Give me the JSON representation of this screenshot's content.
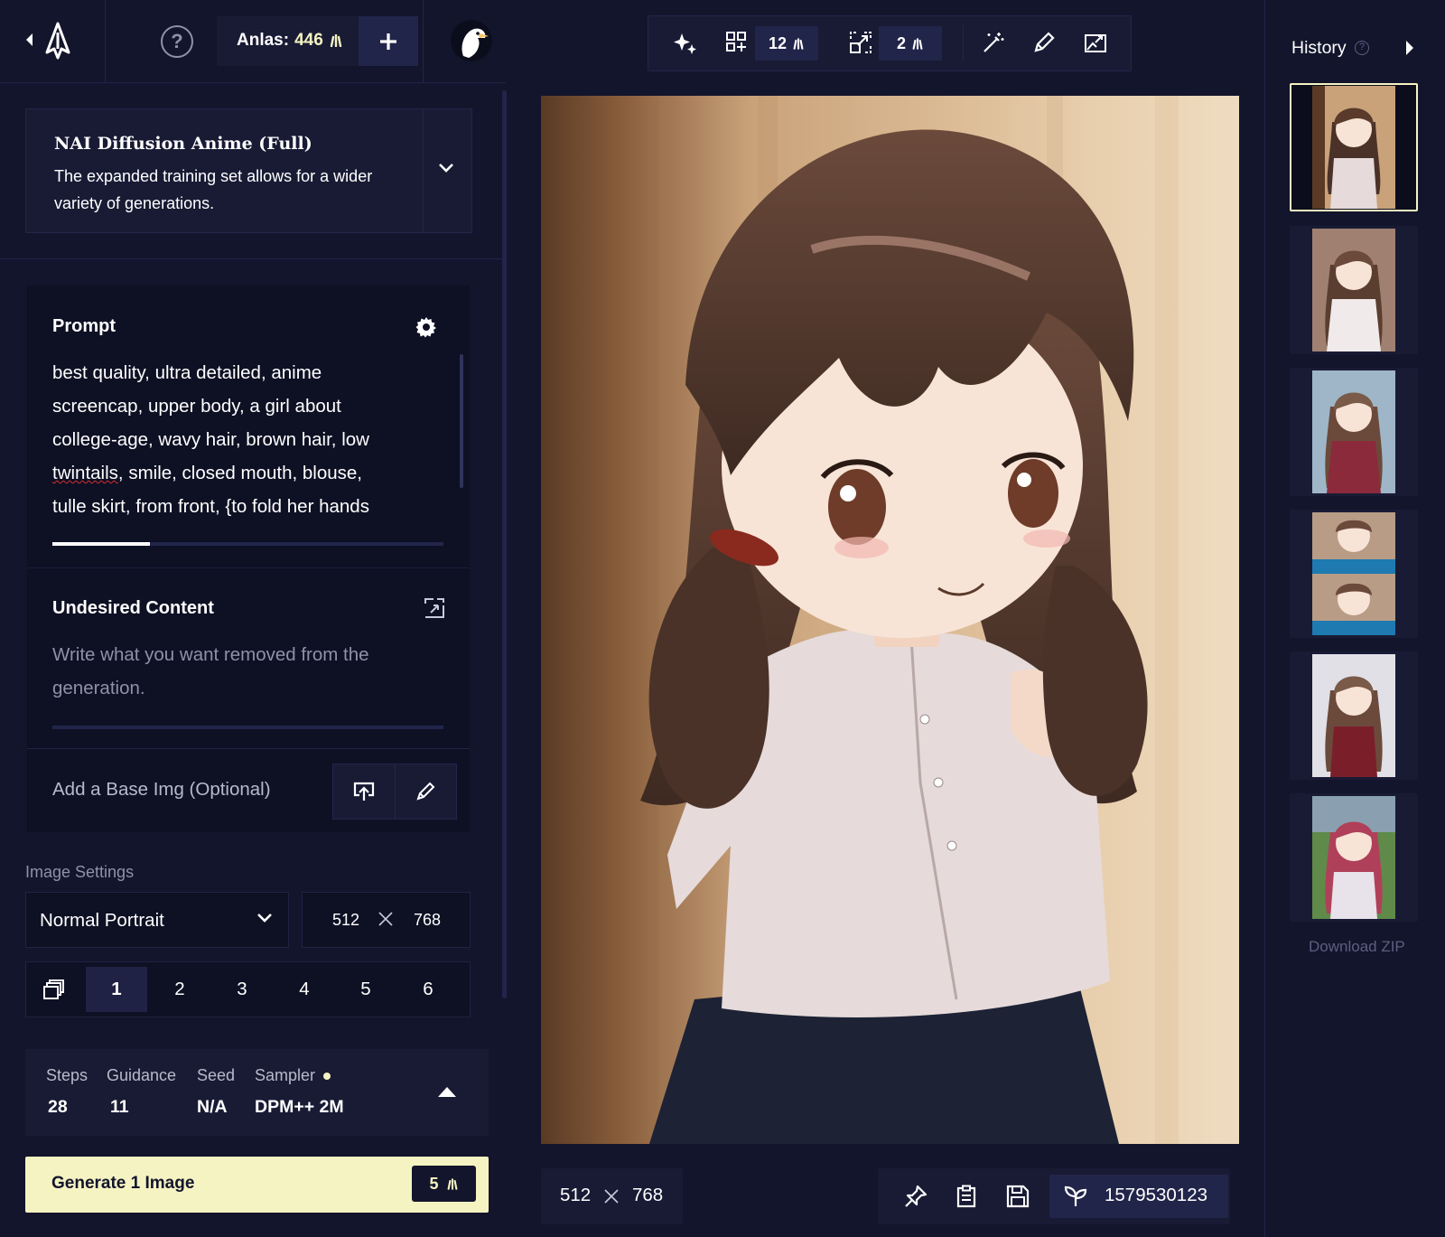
{
  "topbar": {
    "anlas_label": "Anlas:",
    "anlas_value": "446",
    "help_label": "?"
  },
  "model": {
    "title": "NAI Diffusion Anime (Full)",
    "description": "The expanded training set allows for a wider variety of generations."
  },
  "prompt": {
    "title": "Prompt",
    "text_before": "best quality,  ultra detailed,  anime\nscreencap,  upper body,  a girl about\ncollege-age,  wavy hair,  brown hair,  low\n",
    "text_misspelled": "twintails",
    "text_after": ",  smile,  closed mouth,  blouse,\ntulle skirt,  from front,  {to fold her hands",
    "progress_fraction": 0.25
  },
  "undesired": {
    "title": "Undesired Content",
    "placeholder": "Write what you want removed from the generation."
  },
  "base_image": {
    "label": "Add a Base Img (Optional)"
  },
  "image_settings": {
    "label": "Image Settings",
    "resolution_preset": "Normal Portrait",
    "width": "512",
    "height": "768",
    "counts": [
      "1",
      "2",
      "3",
      "4",
      "5",
      "6"
    ],
    "selected_count": "1"
  },
  "params": {
    "steps_label": "Steps",
    "steps_value": "28",
    "guidance_label": "Guidance",
    "guidance_value": "11",
    "seed_label": "Seed",
    "seed_value": "N/A",
    "sampler_label": "Sampler",
    "sampler_value": "DPM++ 2M"
  },
  "generate": {
    "label": "Generate 1 Image",
    "cost": "5"
  },
  "toolbar": {
    "variations_cost": "12",
    "upscale_cost": "2",
    "icons": [
      "sparkle-icon",
      "variations-icon",
      "upscale-icon",
      "magic-wand-icon",
      "paintbrush-icon",
      "image-edit-icon"
    ]
  },
  "image_footer": {
    "width": "512",
    "height": "768",
    "seed": "1579530123",
    "icons": [
      "pin-icon",
      "clipboard-icon",
      "save-icon",
      "seed-icon"
    ]
  },
  "history": {
    "title": "History",
    "thumb_count": 6,
    "download_label": "Download ZIP"
  },
  "colors": {
    "background": "#13152c",
    "panel": "#191b35",
    "accent": "#f5f3c2",
    "error_underline": "#d62d2d"
  }
}
